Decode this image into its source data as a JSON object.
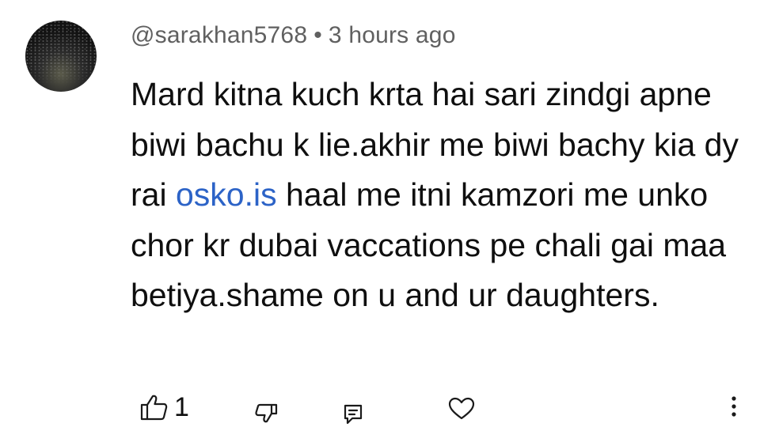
{
  "comment": {
    "author": "@sarakhan5768",
    "separator": "•",
    "time": "3 hours ago",
    "text_before_link": "Mard kitna kuch krta hai sari zindgi apne biwi bachu k lie.akhir me biwi bachy kia dy rai ",
    "link_text": "osko.is",
    "text_after_link": " haal me itni kamzori me unko chor kr dubai vaccations pe chali gai maa betiya.shame on u and ur daughters.",
    "link_color": "#2c63c7"
  },
  "actions": {
    "like_count": "1",
    "icons": [
      "thumbs-up-icon",
      "thumbs-down-icon",
      "reply-icon",
      "heart-icon",
      "more-icon"
    ]
  }
}
